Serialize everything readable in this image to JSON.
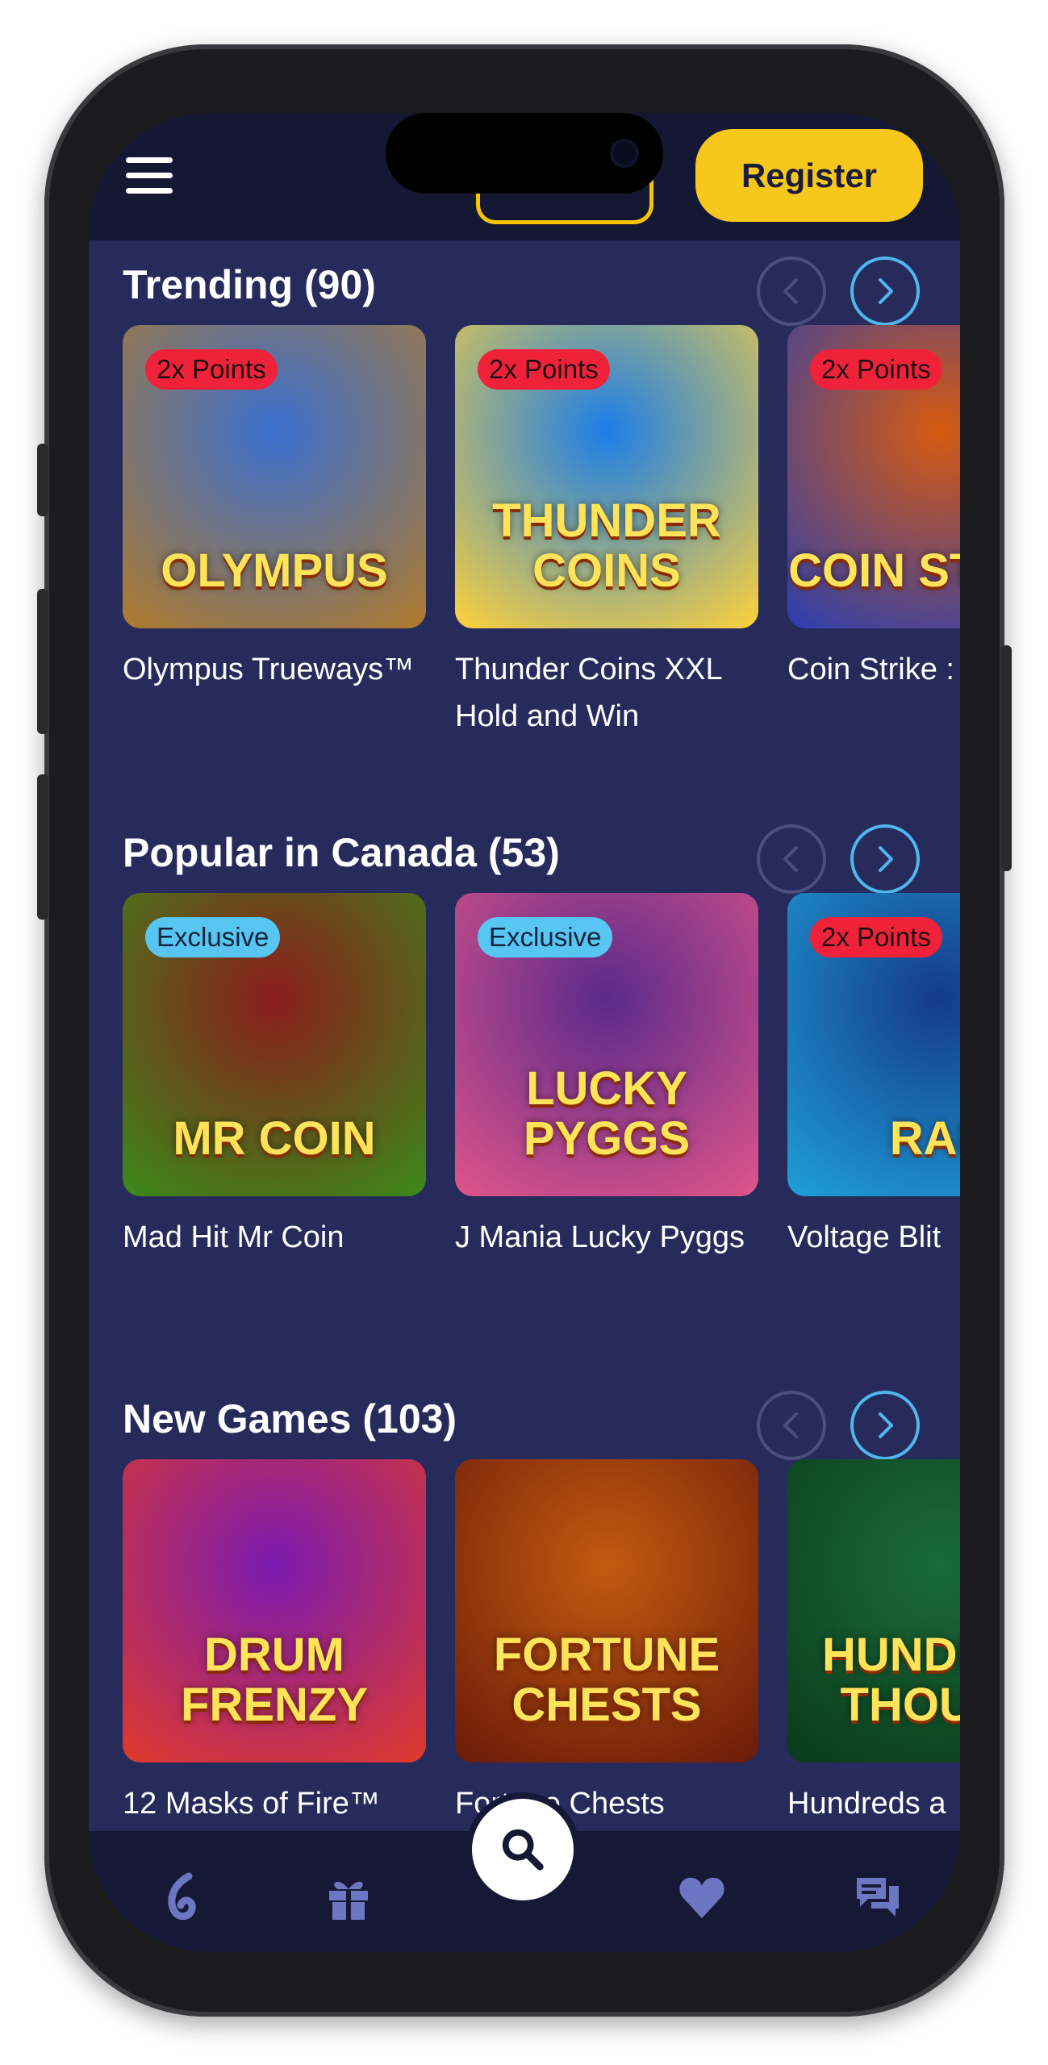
{
  "header": {
    "register_label": "Register"
  },
  "sections": [
    {
      "title": "Trending (90)",
      "games": [
        {
          "name": "Olympus Trueways™",
          "badge": "2x Points",
          "badge_type": "points",
          "art_text": "OLYMPUS",
          "colors": [
            "#3a6fd0",
            "#b07a2a"
          ]
        },
        {
          "name": "Thunder Coins XXL Hold and Win",
          "badge": "2x Points",
          "badge_type": "points",
          "art_text": "THUNDER COINS",
          "colors": [
            "#1c7ee8",
            "#ffd23a"
          ]
        },
        {
          "name": "Coin Strike : and Win",
          "badge": "2x Points",
          "badge_type": "points",
          "art_text": "COIN STRIKE",
          "colors": [
            "#d65a10",
            "#2a3fb0"
          ]
        }
      ]
    },
    {
      "title": "Popular in Canada (53)",
      "games": [
        {
          "name": "Mad Hit Mr Coin",
          "badge": "Exclusive",
          "badge_type": "exclusive",
          "art_text": "MR COIN",
          "colors": [
            "#8a1c1c",
            "#3a8a1a"
          ]
        },
        {
          "name": "J Mania Lucky Pyggs",
          "badge": "Exclusive",
          "badge_type": "exclusive",
          "art_text": "LUCKY PYGGS",
          "colors": [
            "#5a2a8a",
            "#e0558a"
          ]
        },
        {
          "name": "Voltage Blit",
          "badge": "2x Points",
          "badge_type": "points",
          "art_text": "RAP",
          "colors": [
            "#153a8a",
            "#1fa0d8"
          ]
        }
      ]
    },
    {
      "title": "New Games (103)",
      "games": [
        {
          "name": "12 Masks of Fire™",
          "badge": "",
          "badge_type": "",
          "art_text": "DRUM FRENZY",
          "colors": [
            "#7a1ab0",
            "#e03a2a"
          ]
        },
        {
          "name": "Fortune Chests",
          "badge": "",
          "badge_type": "",
          "art_text": "FORTUNE CHESTS",
          "colors": [
            "#c25a10",
            "#6a1a0a"
          ]
        },
        {
          "name": "Hundreds a",
          "badge": "",
          "badge_type": "",
          "art_text": "HUNDRED THOUSA",
          "colors": [
            "#1a6a3a",
            "#0a3a1a"
          ]
        }
      ]
    }
  ],
  "bottom_nav": {
    "items": [
      "logo-icon",
      "gift-icon",
      "search-icon",
      "heart-icon",
      "chat-icon"
    ]
  }
}
